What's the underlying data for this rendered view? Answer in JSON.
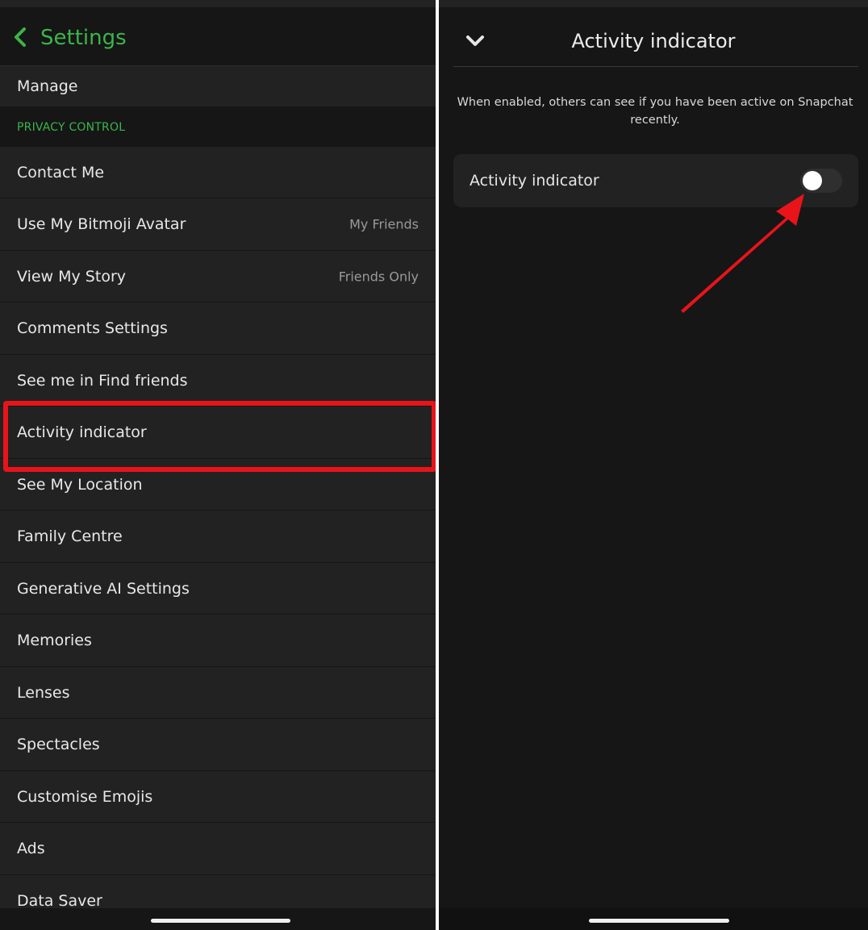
{
  "left_panel": {
    "header": {
      "title": "Settings"
    },
    "rows": [
      {
        "label": "Manage",
        "value": ""
      },
      {
        "label": "Contact Me",
        "value": ""
      },
      {
        "label": "Use My Bitmoji Avatar",
        "value": "My Friends"
      },
      {
        "label": "View My Story",
        "value": "Friends Only"
      },
      {
        "label": "Comments Settings",
        "value": ""
      },
      {
        "label": "See me in Find friends",
        "value": ""
      },
      {
        "label": "Activity indicator",
        "value": ""
      },
      {
        "label": "See My Location",
        "value": ""
      },
      {
        "label": "Family Centre",
        "value": ""
      },
      {
        "label": "Generative AI Settings",
        "value": ""
      },
      {
        "label": "Memories",
        "value": ""
      },
      {
        "label": "Lenses",
        "value": ""
      },
      {
        "label": "Spectacles",
        "value": ""
      },
      {
        "label": "Customise Emojis",
        "value": ""
      },
      {
        "label": "Ads",
        "value": ""
      },
      {
        "label": "Data Saver",
        "value": ""
      }
    ],
    "section_header": "PRIVACY CONTROL",
    "highlighted_row": "Activity indicator"
  },
  "right_panel": {
    "title": "Activity indicator",
    "description": "When enabled, others can see if you have been active on Snapchat recently.",
    "toggle_row": {
      "label": "Activity indicator",
      "enabled": false
    }
  },
  "icons": {
    "back": "chevron-left-icon",
    "collapse": "chevron-down-icon"
  },
  "colors": {
    "accent_green": "#3cb44a",
    "annotation_red": "#e8141a",
    "background": "#1d1d1d"
  }
}
